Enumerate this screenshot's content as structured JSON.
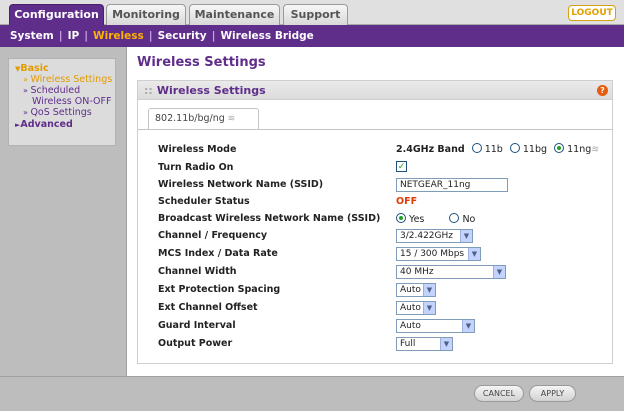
{
  "tabs": [
    {
      "label": "Configuration",
      "active": true
    },
    {
      "label": "Monitoring",
      "active": false
    },
    {
      "label": "Maintenance",
      "active": false
    },
    {
      "label": "Support",
      "active": false
    }
  ],
  "logout_label": "LOGOUT",
  "subnav": [
    {
      "label": "System",
      "active": false
    },
    {
      "label": "IP",
      "active": false
    },
    {
      "label": "Wireless",
      "active": true
    },
    {
      "label": "Security",
      "active": false
    },
    {
      "label": "Wireless Bridge",
      "active": false
    }
  ],
  "sidebar": {
    "basic": "Basic",
    "items": [
      "Wireless Settings",
      "Scheduled",
      "Wireless ON-OFF",
      "QoS Settings"
    ],
    "advanced": "Advanced"
  },
  "page_title": "Wireless Settings",
  "panel_title": "Wireless Settings",
  "help_label": "?",
  "subtab_label": "802.11b/bg/ng",
  "form": {
    "wireless_mode": {
      "label": "Wireless Mode",
      "band": "2.4GHz Band",
      "options": [
        "11b",
        "11bg",
        "11ng"
      ],
      "selected": "11ng"
    },
    "turn_radio_on": {
      "label": "Turn Radio On",
      "checked": true
    },
    "ssid": {
      "label": "Wireless Network Name (SSID)",
      "value": "NETGEAR_11ng"
    },
    "scheduler": {
      "label": "Scheduler Status",
      "value": "OFF"
    },
    "broadcast": {
      "label": "Broadcast Wireless Network Name (SSID)",
      "options": [
        "Yes",
        "No"
      ],
      "selected": "Yes"
    },
    "channel": {
      "label": "Channel / Frequency",
      "value": "3/2.422GHz"
    },
    "mcs": {
      "label": "MCS Index / Data Rate",
      "value": "15 / 300 Mbps"
    },
    "width": {
      "label": "Channel Width",
      "value": "40 MHz"
    },
    "ext_spacing": {
      "label": "Ext Protection Spacing",
      "value": "Auto"
    },
    "ext_offset": {
      "label": "Ext Channel Offset",
      "value": "Auto"
    },
    "guard": {
      "label": "Guard Interval",
      "value": "Auto"
    },
    "power": {
      "label": "Output Power",
      "value": "Full"
    }
  },
  "buttons": {
    "cancel": "CANCEL",
    "apply": "APPLY"
  },
  "icons": {
    "wifi": "wifi-icon",
    "help": "help-icon",
    "check": "checkmark-icon",
    "dropdown": "chevron-down-icon"
  }
}
